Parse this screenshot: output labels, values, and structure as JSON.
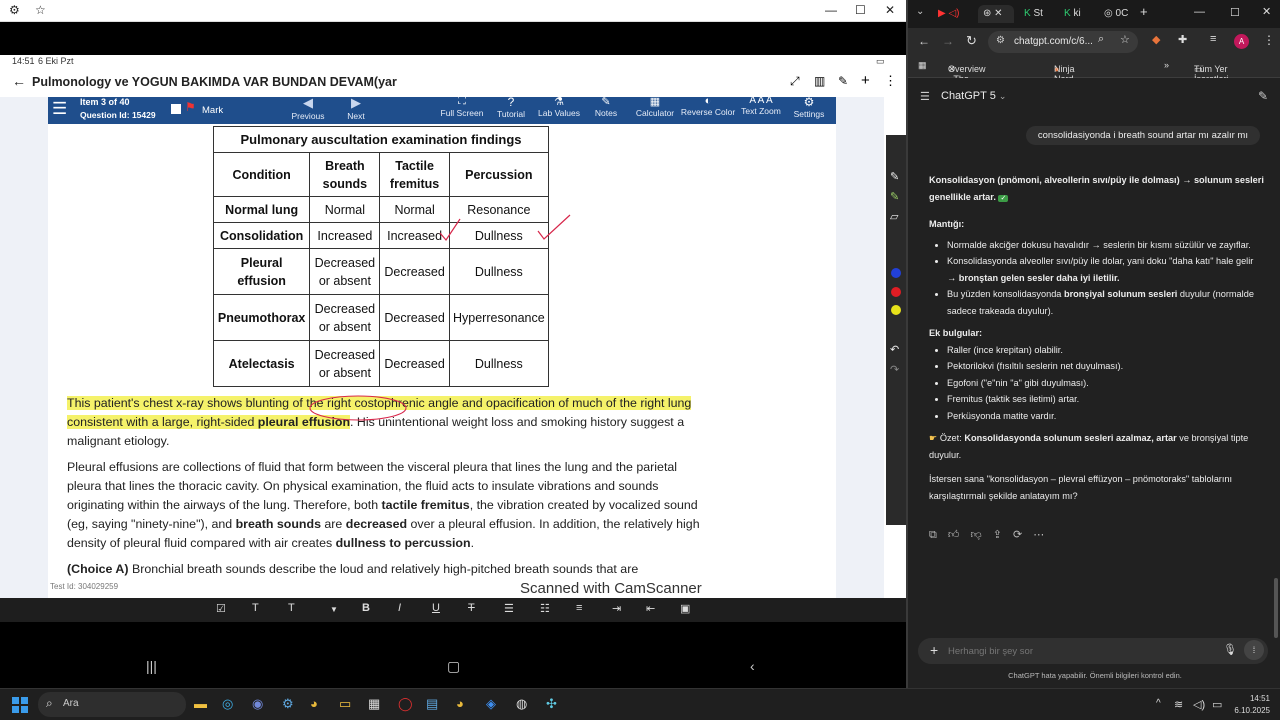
{
  "left_window": {
    "status_time": "14:51",
    "status_date": "6 Eki Pzt",
    "title": "Pulmonology ve YOGUN BAKIMDA VAR BUNDAN DEVAM(yar",
    "question": {
      "item": "Item 3 of 40",
      "id": "Question Id: 15429",
      "mark_label": "Mark"
    },
    "toolbar": [
      {
        "label": "Previous",
        "icon": "triangle-left-icon"
      },
      {
        "label": "Next",
        "icon": "triangle-right-icon"
      },
      {
        "label": "Full Screen",
        "icon": "fullscreen-icon"
      },
      {
        "label": "Tutorial",
        "icon": "question-icon"
      },
      {
        "label": "Lab Values",
        "icon": "flask-icon"
      },
      {
        "label": "Notes",
        "icon": "pencil-icon"
      },
      {
        "label": "Calculator",
        "icon": "calculator-icon"
      },
      {
        "label": "Reverse Color",
        "icon": "contrast-icon"
      },
      {
        "label": "Text Zoom",
        "icon": "text-zoom-icon"
      },
      {
        "label": "Settings",
        "icon": "gear-icon"
      }
    ],
    "table": {
      "caption": "Pulmonary auscultation examination findings",
      "headers": [
        "Condition",
        "Breath sounds",
        "Tactile fremitus",
        "Percussion"
      ],
      "rows": [
        [
          "Normal lung",
          "Normal",
          "Normal",
          "Resonance"
        ],
        [
          "Consolidation",
          "Increased",
          "Increased",
          "Dullness"
        ],
        [
          "Pleural effusion",
          "Decreased or absent",
          "Decreased",
          "Dullness"
        ],
        [
          "Pneumothorax",
          "Decreased or absent",
          "Decreased",
          "Hyperresonance"
        ],
        [
          "Atelectasis",
          "Decreased or absent",
          "Decreased",
          "Dullness"
        ]
      ]
    },
    "para1": {
      "p1": "This patient's chest x-ray shows blunting of the right costophrenic angle and opacification of much of the right lung consistent with a large, right-sided ",
      "bold": "pleural effusion",
      "p2": ".  His unintentional weight loss and smoking history suggest a malignant etiology."
    },
    "para2": {
      "p1": "Pleural effusions are collections of fluid that form between the visceral pleura that lines the lung and the parietal pleura that lines the thoracic cavity.  On physical examination, the fluid acts to insulate vibrations and sounds originating within the airways of the lung.  Therefore, both ",
      "b1": "tactile fremitus",
      "p2": ", the vibration created by vocalized sound (eg, saying \"ninety-nine\"), and ",
      "b2": "breath sounds",
      "p3": " are ",
      "b3": "decreased",
      "p4": " over a pleural effusion.  In addition, the relatively high density of pleural fluid compared with air creates ",
      "b4": "dullness to percussion",
      "p5": "."
    },
    "para3": {
      "bold": "(Choice A)",
      "text": "  Bronchial breath sounds describe the loud and relatively high-pitched breath sounds that are"
    },
    "test_id": "Test Id: 304029259",
    "watermark": "Scanned with CamScanner"
  },
  "browser": {
    "tabs": [
      "St",
      "ki",
      "0C"
    ],
    "url": "chatgpt.com/c/6...",
    "bookmarks": [
      "Overview - The Lea...",
      "Ninja Nerd - Medici...",
      "Tüm Yer İşaretleri"
    ],
    "model": "ChatGPT 5",
    "user_message": "consolidasiyonda i breath sound artar mı azalır mı",
    "reply": {
      "intro_bold": "Konsolidasyon (pnömoni, alveollerin sıvı/püy ile dolması) → solunum sesleri genellikle artar.",
      "mantik_title": "Mantığı:",
      "m1": "Normalde akciğer dokusu havalıdır → seslerin bir kısmı süzülür ve zayıflar.",
      "m2a": "Konsolidasyonda alveoller sıvı/püy ile dolar, yani doku \"daha katı\" hale gelir → ",
      "m2b": "bronştan gelen sesler daha iyi iletilir.",
      "m3a": "Bu yüzden konsolidasyonda ",
      "m3b": "bronşiyal solunum sesleri",
      "m3c": " duyulur (normalde sadece trakeada duyulur).",
      "ek_title": "Ek bulgular:",
      "e1": "Raller (ince krepitan) olabilir.",
      "e2": "Pektorilokvi (fısıltılı seslerin net duyulması).",
      "e3": "Egofoni (\"e\"nin \"a\" gibi duyulması).",
      "e4": "Fremitus (taktik ses iletimi) artar.",
      "e5": "Perküsyonda matite vardır.",
      "ozet_a": "Özet: ",
      "ozet_b": "Konsolidasyonda solunum sesleri azalmaz, artar",
      "ozet_c": " ve bronşiyal tipte duyulur.",
      "offer": "İstersen sana \"konsolidasyon – plevral effüzyon – pnömotoraks\" tablolarını karşılaştırmalı şekilde anlatayım mı?"
    },
    "input_placeholder": "Herhangi bir şey sor",
    "disclaimer": "ChatGPT hata yapabilir. Önemli bilgileri kontrol edin."
  },
  "taskbar": {
    "search_label": "Ara",
    "time": "14:51",
    "date": "6.10.2025"
  },
  "colors": {
    "highlight": "#f5f26a",
    "uworld_bar": "#1f4e8c",
    "annotation_red": "#d7264a"
  }
}
